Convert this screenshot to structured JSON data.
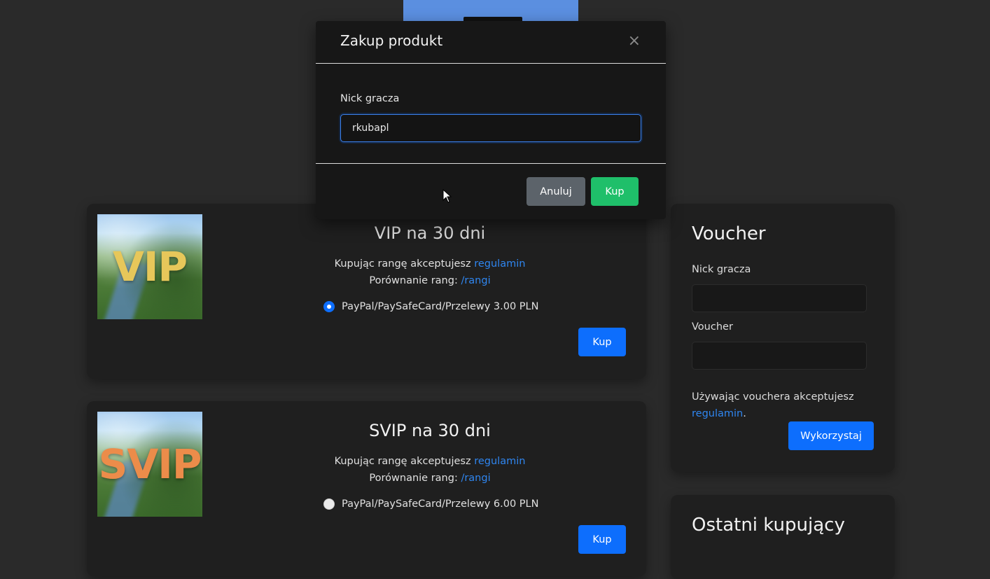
{
  "products": [
    {
      "thumb_text": "VIP",
      "thumb_color": "#e7c75a",
      "title": "VIP na 30 dni",
      "accept_text": "Kupując rangę akceptujesz ",
      "accept_link": "regulamin",
      "compare_text": "Porównanie rang: ",
      "compare_link": "/rangi",
      "option_label": "PayPal/PaySafeCard/Przelewy 3.00 PLN",
      "option_selected": true,
      "buy_label": "Kup"
    },
    {
      "thumb_text": "SVIP",
      "thumb_color": "#ec8c4a",
      "title": "SVIP na 30 dni",
      "accept_text": "Kupując rangę akceptujesz ",
      "accept_link": "regulamin",
      "compare_text": "Porównanie rang: ",
      "compare_link": "/rangi",
      "option_label": "PayPal/PaySafeCard/Przelewy 6.00 PLN",
      "option_selected": false,
      "buy_label": "Kup"
    }
  ],
  "voucher": {
    "title": "Voucher",
    "nick_label": "Nick gracza",
    "voucher_label": "Voucher",
    "note_text": "Używając vouchera akceptujesz ",
    "note_link": "regulamin",
    "note_end": ".",
    "submit_label": "Wykorzystaj"
  },
  "recent": {
    "title": "Ostatni kupujący"
  },
  "modal": {
    "title": "Zakup produkt",
    "close": "×",
    "field_label": "Nick gracza",
    "field_value": "rkubapl",
    "cancel_label": "Anuluj",
    "confirm_label": "Kup"
  },
  "colors": {
    "accent": "#0d6efd",
    "success": "#1fbf6a",
    "secondary": "#5c636a",
    "link": "#2f86f0"
  }
}
